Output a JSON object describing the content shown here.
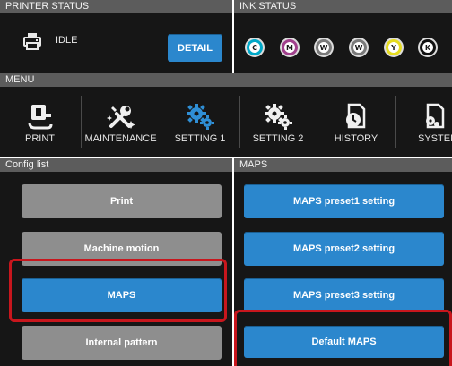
{
  "printer_status": {
    "header": "PRINTER STATUS",
    "state": "IDLE",
    "detail_label": "DETAIL",
    "icon": "printer-icon"
  },
  "ink_status": {
    "header": "INK STATUS",
    "inks": [
      {
        "label": "C",
        "color": "#00a8c8"
      },
      {
        "label": "M",
        "color": "#a0408c"
      },
      {
        "label": "W",
        "color": "#7a7a7a"
      },
      {
        "label": "W",
        "color": "#7a7a7a"
      },
      {
        "label": "Y",
        "color": "#e6dc20"
      },
      {
        "label": "K",
        "color": "#111111"
      }
    ]
  },
  "menu": {
    "header": "MENU",
    "items": [
      {
        "label": "PRINT",
        "icon": "print-icon",
        "active": false
      },
      {
        "label": "MAINTENANCE",
        "icon": "tools-icon",
        "active": false
      },
      {
        "label": "SETTING 1",
        "icon": "gears-icon",
        "active": true
      },
      {
        "label": "SETTING 2",
        "icon": "gears-icon",
        "active": false
      },
      {
        "label": "HISTORY",
        "icon": "history-icon",
        "active": false
      },
      {
        "label": "SYSTEM",
        "icon": "system-icon",
        "active": false
      }
    ]
  },
  "config_list": {
    "header": "Config list",
    "items": [
      {
        "label": "Print",
        "state": "inactive"
      },
      {
        "label": "Machine motion",
        "state": "inactive"
      },
      {
        "label": "MAPS",
        "state": "selected"
      },
      {
        "label": "Internal pattern",
        "state": "inactive"
      }
    ]
  },
  "maps": {
    "header": "MAPS",
    "items": [
      {
        "label": "MAPS preset1 setting"
      },
      {
        "label": "MAPS preset2 setting"
      },
      {
        "label": "MAPS preset3 setting"
      },
      {
        "label": "Default MAPS"
      }
    ]
  },
  "colors": {
    "accent_blue": "#2b87cd",
    "active_icon": "#2f8fd6",
    "highlight_red": "#c8161d"
  }
}
